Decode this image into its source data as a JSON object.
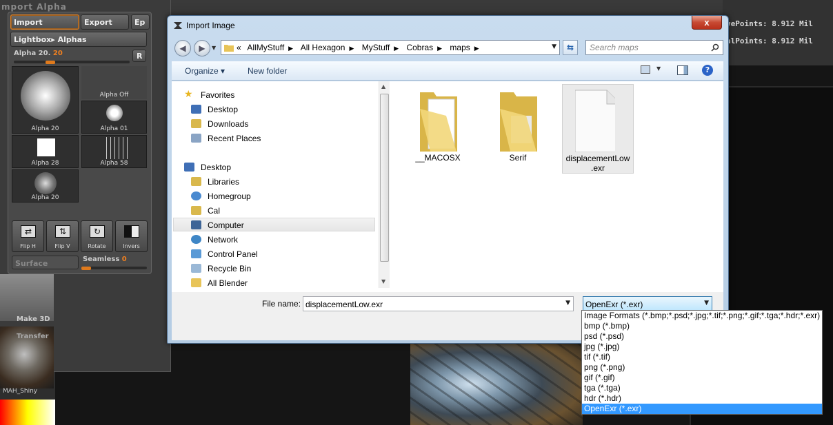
{
  "app": {
    "panel_title": "mport Alpha",
    "stats": [
      "vePoints: 8.912 Mil",
      "alPoints: 8.912 Mil"
    ],
    "import_label": "Import",
    "export_label": "Export",
    "ep_label": "Ep",
    "lightbox_label": "Lightbox▸ Alphas",
    "alpha_label": "Alpha 20.",
    "alpha_value": "20",
    "r_label": "R",
    "tiles": [
      "Alpha 20",
      "Alpha Off",
      "Alpha 01",
      "Alpha 28",
      "Alpha 58",
      "Alpha 20"
    ],
    "tools": [
      "Flip H",
      "Flip V",
      "Rotate",
      "Invers"
    ],
    "surface_label": "Surface",
    "seamless_label": "Seamless",
    "seamless_value": "0",
    "make3d_label": "Make 3D",
    "transfer_label": "Transfer",
    "material_label": "MAH_Shiny"
  },
  "dialog": {
    "title": "Import Image",
    "close_symbol": "x",
    "breadcrumbs": [
      "«",
      "AllMyStuff",
      "All Hexagon",
      "MyStuff",
      "Cobras",
      "maps"
    ],
    "search_placeholder": "Search maps",
    "organize_label": "Organize ▾",
    "new_folder_label": "New folder",
    "nav_items": [
      {
        "label": "Favorites",
        "icon": "star-icon"
      },
      {
        "label": "Desktop",
        "icon": "desktop-icon"
      },
      {
        "label": "Downloads",
        "icon": "downloads-icon"
      },
      {
        "label": "Recent Places",
        "icon": "recent-places-icon"
      },
      {
        "label": "Desktop",
        "icon": "desktop-icon"
      },
      {
        "label": "Libraries",
        "icon": "libraries-icon"
      },
      {
        "label": "Homegroup",
        "icon": "homegroup-icon"
      },
      {
        "label": "Cal",
        "icon": "user-folder-icon"
      },
      {
        "label": "Computer",
        "icon": "computer-icon"
      },
      {
        "label": "Network",
        "icon": "network-icon"
      },
      {
        "label": "Control Panel",
        "icon": "control-panel-icon"
      },
      {
        "label": "Recycle Bin",
        "icon": "recycle-bin-icon"
      },
      {
        "label": "All Blender",
        "icon": "folder-icon"
      }
    ],
    "files": [
      {
        "name": "__MACOSX",
        "type": "folder"
      },
      {
        "name": "Serif",
        "type": "folder"
      },
      {
        "name": "displacementLow\n.exr",
        "type": "file"
      }
    ],
    "file_name_label": "File name:",
    "file_name_value": "displacementLow.exr",
    "file_type_value": "OpenExr (*.exr)",
    "file_type_options": [
      "Image Formats (*.bmp;*.psd;*.jpg;*.tif;*.png;*.gif;*.tga;*.hdr;*.exr)",
      "bmp (*.bmp)",
      "psd (*.psd)",
      "jpg (*.jpg)",
      "tif (*.tif)",
      "png (*.png)",
      "gif (*.gif)",
      "tga (*.tga)",
      "hdr (*.hdr)",
      "OpenExr (*.exr)"
    ],
    "selected_option": "OpenExr (*.exr)",
    "colors": {
      "selection": "#3399ff",
      "title_bar": "#c9dcef",
      "accent_orange": "#f08020"
    }
  }
}
